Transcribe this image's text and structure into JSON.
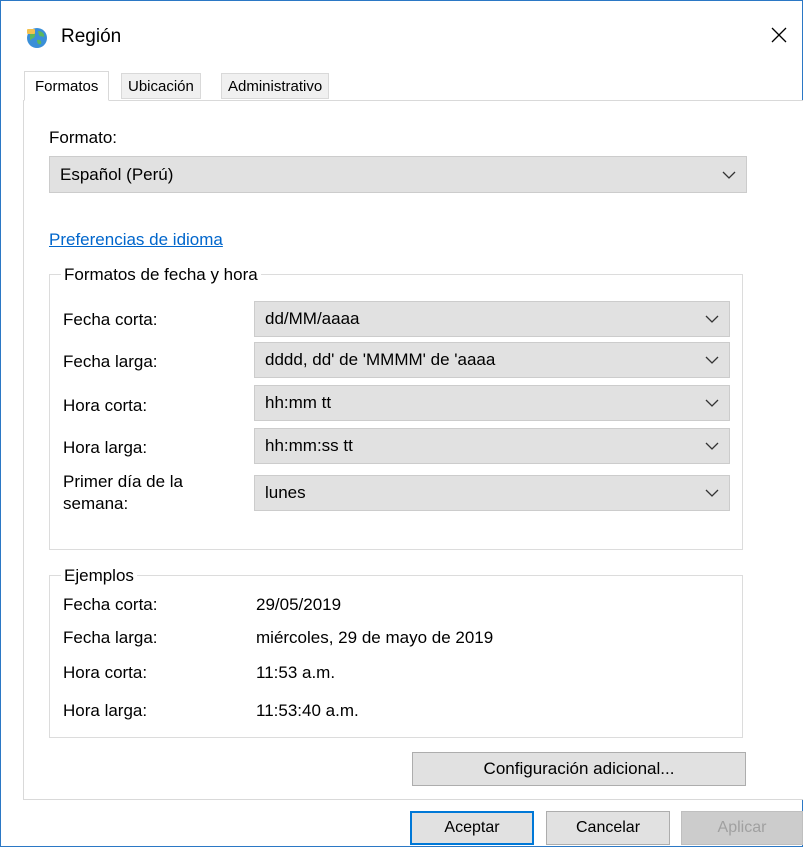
{
  "window": {
    "title": "Región"
  },
  "tabs": [
    {
      "label": "Formatos",
      "active": true
    },
    {
      "label": "Ubicación",
      "active": false
    },
    {
      "label": "Administrativo",
      "active": false
    }
  ],
  "format": {
    "label": "Formato:",
    "selected": "Español (Perú)"
  },
  "language_link": "Preferencias de idioma",
  "date_time_group": {
    "legend": "Formatos de fecha y hora",
    "rows": [
      {
        "label": "Fecha corta:",
        "value": "dd/MM/aaaa"
      },
      {
        "label": "Fecha larga:",
        "value": "dddd, dd' de 'MMMM' de 'aaaa"
      },
      {
        "label": "Hora corta:",
        "value": "hh:mm tt"
      },
      {
        "label": "Hora larga:",
        "value": "hh:mm:ss tt"
      },
      {
        "label": "Primer día de la semana:",
        "value": "lunes"
      }
    ]
  },
  "examples_group": {
    "legend": "Ejemplos",
    "rows": [
      {
        "label": "Fecha corta:",
        "value": "29/05/2019"
      },
      {
        "label": "Fecha larga:",
        "value": "miércoles, 29 de mayo de 2019"
      },
      {
        "label": "Hora corta:",
        "value": "11:53 a.m."
      },
      {
        "label": "Hora larga:",
        "value": "11:53:40 a.m."
      }
    ]
  },
  "buttons": {
    "additional": "Configuración adicional...",
    "ok": "Aceptar",
    "cancel": "Cancelar",
    "apply": "Aplicar"
  },
  "icons": {
    "app": "globe-region-icon",
    "close": "close-icon",
    "dropdown": "chevron-down-icon"
  },
  "colors": {
    "window_border": "#2b78c5",
    "link": "#0066cc",
    "primary_button_border": "#0078d7",
    "combo_bg": "#e1e1e1"
  }
}
